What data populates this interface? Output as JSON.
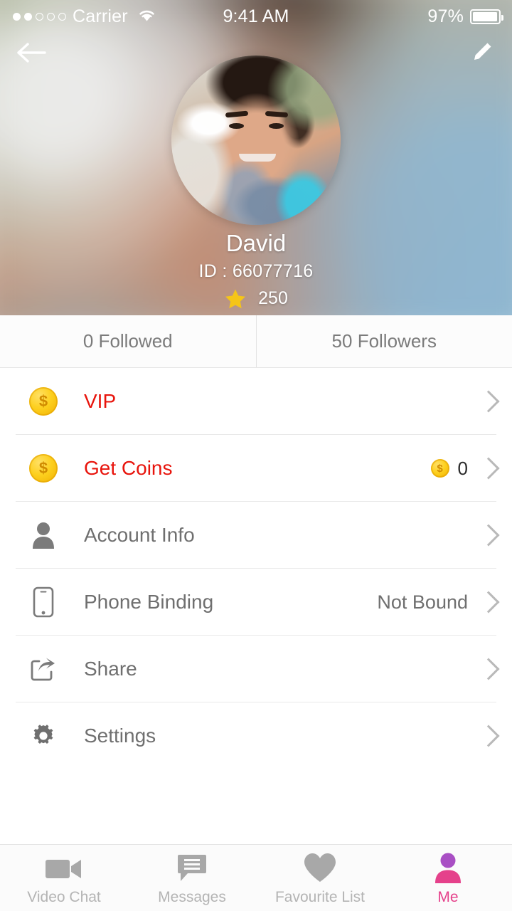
{
  "status_bar": {
    "carrier": "Carrier",
    "signal_dots_filled": 2,
    "signal_dots_total": 5,
    "wifi_icon": "wifi-icon",
    "time": "9:41 AM",
    "battery_percent": "97%"
  },
  "header": {
    "back_icon": "back-arrow-icon",
    "edit_icon": "pencil-edit-icon",
    "avatar": "user-avatar",
    "name": "David",
    "id_text": "ID : 66077716",
    "star_icon": "star-icon",
    "level_points": "250"
  },
  "follow_tabs": [
    {
      "label": "0 Followed",
      "name": "tab-followed"
    },
    {
      "label": "50 Followers",
      "name": "tab-followers"
    }
  ],
  "menu": {
    "items": [
      {
        "label": "VIP",
        "icon": "coin-dollar-icon",
        "accent": true,
        "value": "",
        "coin": false
      },
      {
        "label": "Get Coins",
        "icon": "coin-dollar-icon",
        "accent": true,
        "value": "0",
        "coin": true
      },
      {
        "label": "Account Info",
        "icon": "person-icon",
        "accent": false,
        "value": "",
        "coin": false
      },
      {
        "label": "Phone Binding",
        "icon": "phone-icon",
        "accent": false,
        "value": "Not Bound",
        "coin": false
      },
      {
        "label": "Share",
        "icon": "share-icon",
        "accent": false,
        "value": "",
        "coin": false
      },
      {
        "label": "Settings",
        "icon": "gear-icon",
        "accent": false,
        "value": "",
        "coin": false
      }
    ],
    "chevron_icon": "chevron-right-icon"
  },
  "tabbar": {
    "items": [
      {
        "label": "Video Chat",
        "icon": "video-camera-icon",
        "active": false
      },
      {
        "label": "Messages",
        "icon": "chat-bubble-icon",
        "active": false
      },
      {
        "label": "Favourite List",
        "icon": "heart-icon",
        "active": false
      },
      {
        "label": "Me",
        "icon": "person-icon",
        "active": true
      }
    ]
  },
  "colors": {
    "accent_red": "#e8140c",
    "active_pink": "#e5418b",
    "active_purple": "#a94fc4",
    "coin_gold": "#fdd01f",
    "star_gold": "#f5c518",
    "muted_text": "#6f6f6f",
    "tab_inactive": "#b4b4b4"
  }
}
